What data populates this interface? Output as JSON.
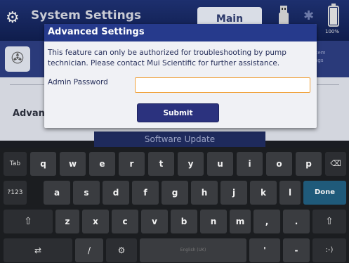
{
  "app": {
    "title": "System Settings",
    "main_button": "Main",
    "battery_percent": "100%",
    "side_label": "stem\nings"
  },
  "content": {
    "section_label": "Advan",
    "software_update": "Software Update"
  },
  "dialog": {
    "title": "Advanced Settings",
    "message": "This feature can only be authorized for troubleshooting by pump technician. Please contact Mui Scientific for further assistance.",
    "password_label": "Admin Password",
    "password_value": "",
    "submit_label": "Submit"
  },
  "keyboard": {
    "row1": [
      "Tab",
      "q",
      "w",
      "e",
      "r",
      "t",
      "y",
      "u",
      "i",
      "o",
      "p",
      "⌫"
    ],
    "row2": [
      "?123",
      "a",
      "s",
      "d",
      "f",
      "g",
      "h",
      "j",
      "k",
      "l",
      "Done"
    ],
    "row3": [
      "⇧",
      "z",
      "x",
      "c",
      "v",
      "b",
      "n",
      "m",
      ",",
      ".",
      "⇧"
    ],
    "row4": [
      "⇄",
      "/",
      "⚙",
      "English (UK)",
      "'",
      "-",
      ":-)"
    ]
  },
  "colors": {
    "dialog_header": "#263a8c",
    "submit_button": "#2b327e",
    "input_focus_border": "#f0a23c",
    "done_key": "#1f5a7a"
  }
}
